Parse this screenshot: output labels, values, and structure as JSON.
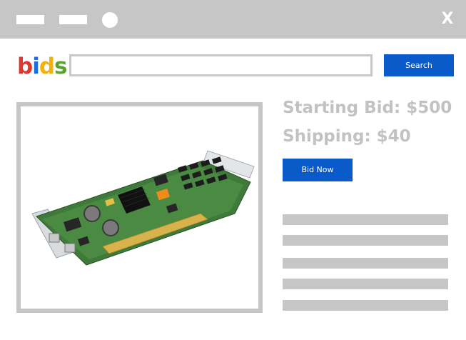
{
  "window": {
    "close_label": "X"
  },
  "logo": {
    "letters": [
      {
        "char": "b",
        "color": "#e0362c"
      },
      {
        "char": "i",
        "color": "#1b6fd8"
      },
      {
        "char": "d",
        "color": "#f2b10c"
      },
      {
        "char": "s",
        "color": "#5aa332"
      }
    ]
  },
  "search": {
    "value": "",
    "placeholder": "",
    "button_label": "Search"
  },
  "listing": {
    "starting_bid": "Starting Bid: $500",
    "shipping": "Shipping: $40",
    "bid_button_label": "Bid Now",
    "image_subject": "pci-expansion-card"
  },
  "colors": {
    "accent": "#0a5bc9",
    "chrome_gray": "#c6c6c6",
    "muted_text": "#c2c2c2"
  }
}
